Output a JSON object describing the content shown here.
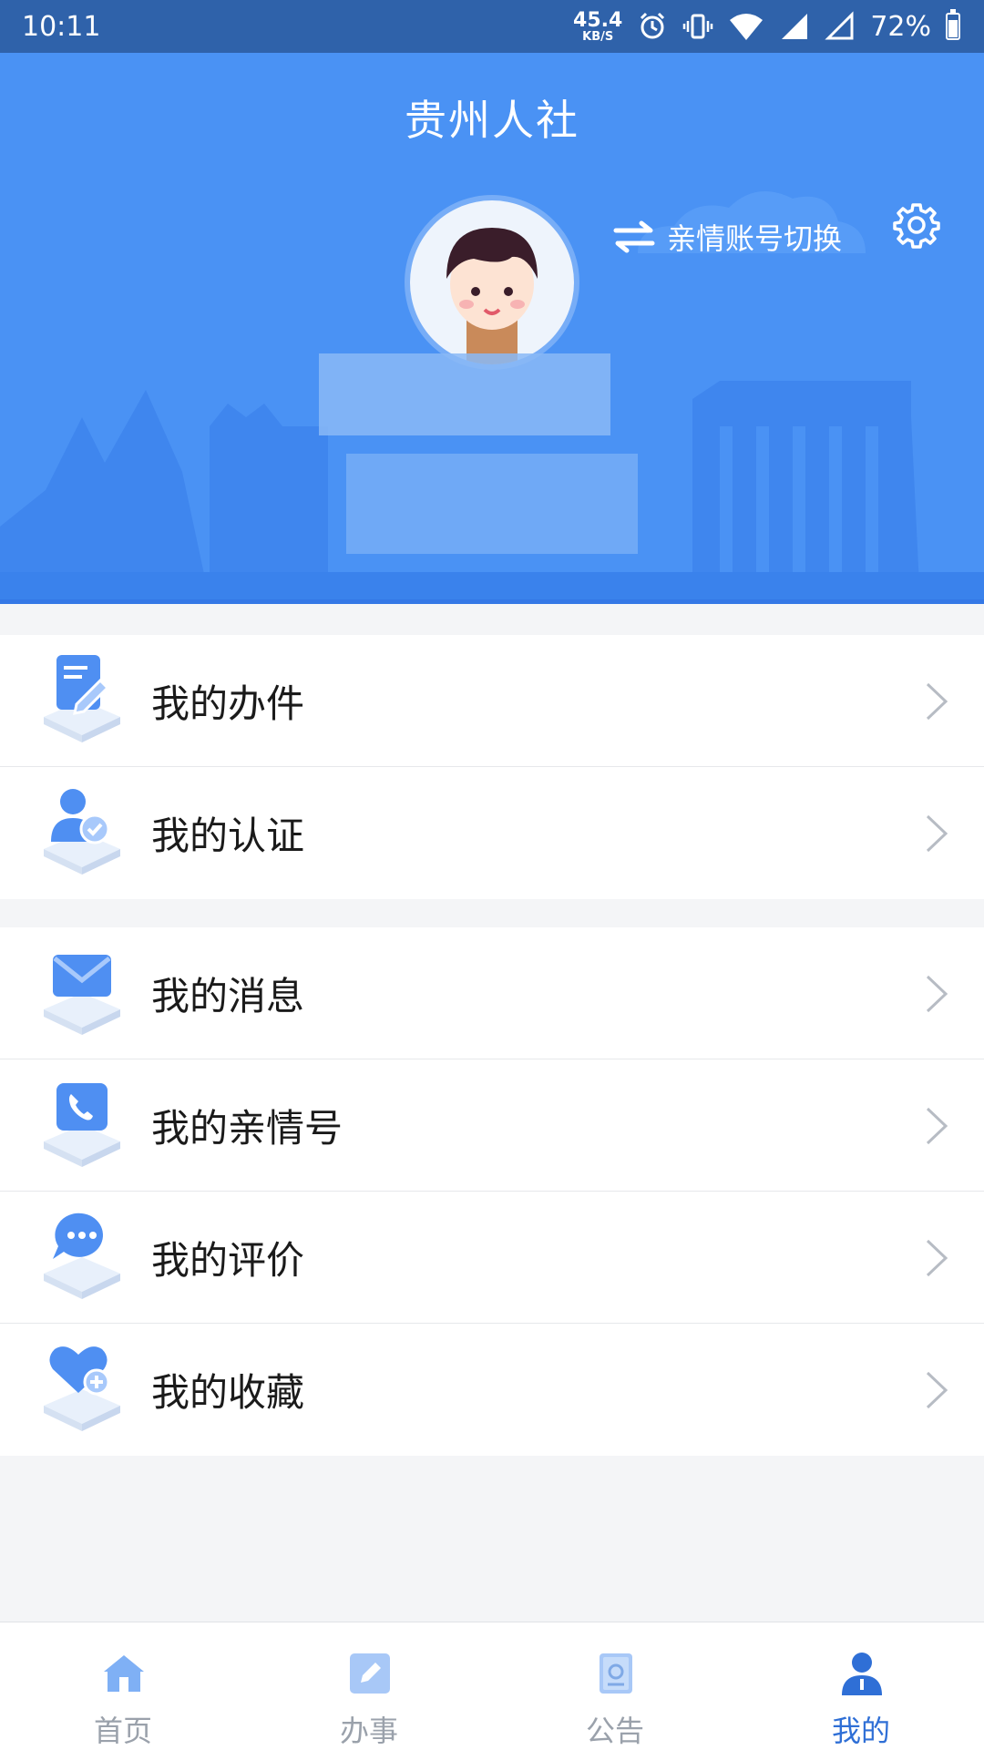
{
  "status_bar": {
    "time": "10:11",
    "net_speed_value": "45.4",
    "net_speed_unit": "KB/S",
    "battery_text": "72%",
    "battery_level": 0.72
  },
  "header": {
    "title": "贵州人社",
    "switch_label": "亲情账号切换"
  },
  "menu_group_1": [
    {
      "label": "我的办件",
      "icon": "document-edit-icon"
    },
    {
      "label": "我的认证",
      "icon": "user-verified-icon"
    }
  ],
  "menu_group_2": [
    {
      "label": "我的消息",
      "icon": "envelope-icon"
    },
    {
      "label": "我的亲情号",
      "icon": "phone-icon"
    },
    {
      "label": "我的评价",
      "icon": "chat-bubble-icon"
    },
    {
      "label": "我的收藏",
      "icon": "heart-plus-icon"
    }
  ],
  "tabbar": {
    "tabs": [
      {
        "label": "首页",
        "icon": "home-icon"
      },
      {
        "label": "办事",
        "icon": "pencil-icon"
      },
      {
        "label": "公告",
        "icon": "notice-book-icon"
      },
      {
        "label": "我的",
        "icon": "person-icon"
      }
    ],
    "active_index": 3
  },
  "colors": {
    "header_blue": "#4a92f4",
    "status_bar": "#2f62aa",
    "accent": "#2f6fd6",
    "tab_inactive": "#9aa1ab"
  }
}
